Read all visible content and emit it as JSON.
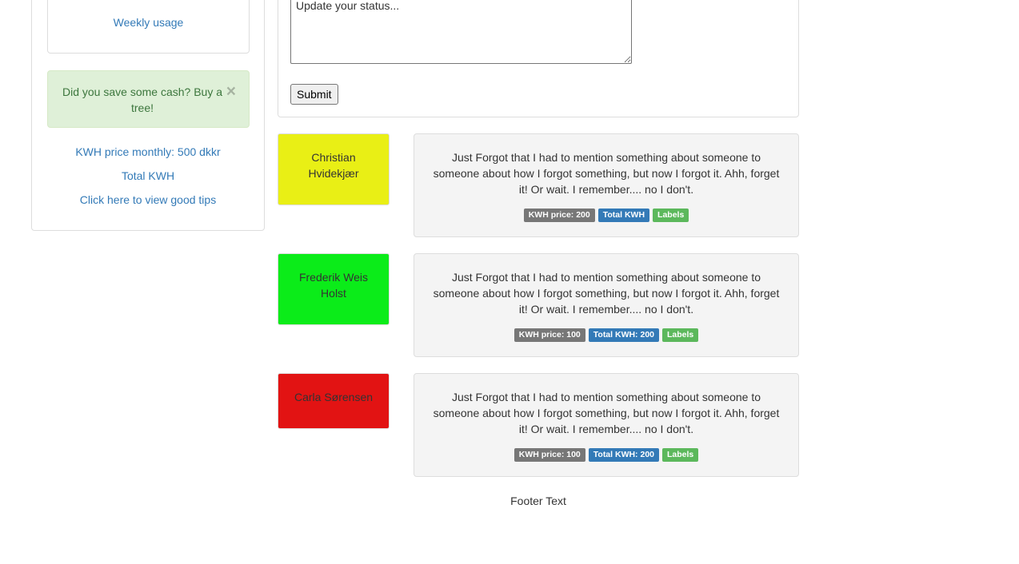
{
  "sidebar": {
    "weekly_usage": "Weekly usage",
    "alert_text": "Did you save some cash? Buy a tree!",
    "alert_close": "×",
    "links": [
      "KWH price monthly: 500 dkkr",
      "Total KWH",
      "Click here to view good tips"
    ]
  },
  "status_form": {
    "placeholder": "Update your status...",
    "submit_label": "Submit"
  },
  "posts": [
    {
      "author": "Christian Hvidekjær",
      "author_color": "#e9ef15",
      "text": "Just Forgot that I had to mention something about someone to someone about how I forgot something, but now I forgot it. Ahh, forget it! Or wait. I remember.... no I don't.",
      "labels": [
        "KWH price: 200",
        "Total KWH",
        "Labels"
      ]
    },
    {
      "author": "Frederik Weis Holst",
      "author_color": "#0bec19",
      "text": "Just Forgot that I had to mention something about someone to someone about how I forgot something, but now I forgot it. Ahh, forget it! Or wait. I remember.... no I don't.",
      "labels": [
        "KWH price: 100",
        "Total KWH: 200",
        "Labels"
      ]
    },
    {
      "author": "Carla Sørensen",
      "author_color": "#e21313",
      "text": "Just Forgot that I had to mention something about someone to someone about how I forgot something, but now I forgot it. Ahh, forget it! Or wait. I remember.... no I don't.",
      "labels": [
        "KWH price: 100",
        "Total KWH: 200",
        "Labels"
      ]
    }
  ],
  "label_colors": [
    "#777777",
    "#337ab7",
    "#5cb85c"
  ],
  "footer": {
    "text": "Footer Text"
  }
}
